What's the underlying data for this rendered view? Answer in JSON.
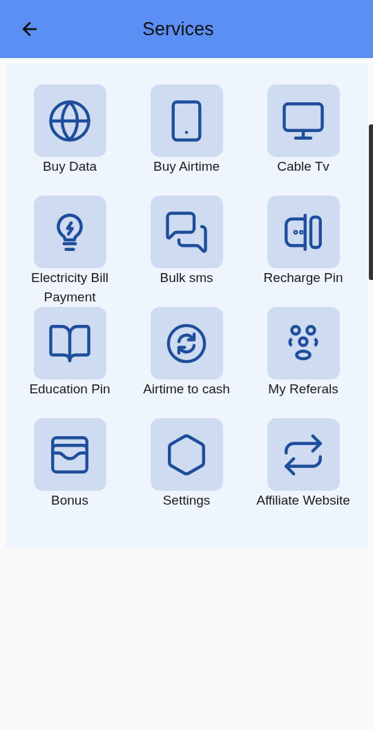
{
  "header": {
    "title": "Services"
  },
  "services": [
    {
      "label": "Buy Data"
    },
    {
      "label": "Buy Airtime"
    },
    {
      "label": "Cable Tv"
    },
    {
      "label": "Electricity Bill Payment"
    },
    {
      "label": "Bulk sms"
    },
    {
      "label": "Recharge Pin"
    },
    {
      "label": "Education Pin"
    },
    {
      "label": "Airtime to cash"
    },
    {
      "label": "My Referals"
    },
    {
      "label": "Bonus"
    },
    {
      "label": "Settings"
    },
    {
      "label": "Affiliate Website"
    }
  ]
}
